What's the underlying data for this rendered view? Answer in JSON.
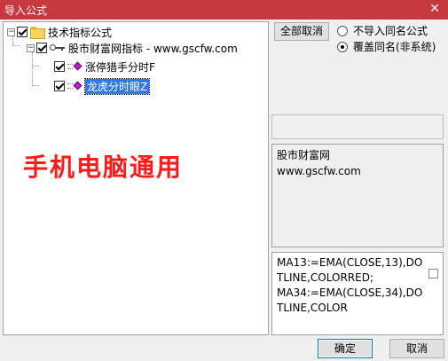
{
  "window": {
    "title": "导入公式",
    "close_glyph": "✕"
  },
  "tree": {
    "root": {
      "label": "技术指标公式",
      "expander": "−",
      "checked": true
    },
    "group": {
      "label": "股市财富网指标 - www.gscfw.com",
      "expander": "−",
      "checked": true
    },
    "items": [
      {
        "label": "涨停猎手分时F",
        "checked": true,
        "selected": false
      },
      {
        "label": "龙虎分时眼Z",
        "checked": true,
        "selected": true
      }
    ]
  },
  "watermark": {
    "text": "手机电脑通用",
    "color": "#ff1a1a"
  },
  "options": {
    "cancel_all_label": "全部取消",
    "radio_no_import": "不导入同名公式",
    "radio_overwrite": "覆盖同名(非系统)",
    "selected_radio": "overwrite"
  },
  "info": {
    "line1": "股市财富网",
    "line2": "www.gscfw.com"
  },
  "code": {
    "text": "MA13:=EMA(CLOSE,13),DOTLINE,COLORRED;\nMA34:=EMA(CLOSE,34),DOTLINE,COLOR"
  },
  "footer": {
    "ok_label": "确定",
    "cancel_label": "取消"
  },
  "colors": {
    "titlebar": "#c8393f",
    "selection": "#3277e6",
    "formula_icon": "#c020c0"
  }
}
